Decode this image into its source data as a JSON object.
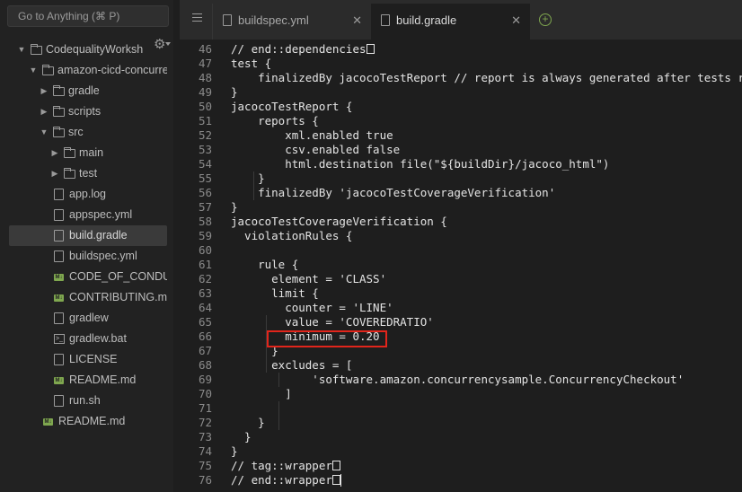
{
  "sidebar": {
    "search_placeholder": "Go to Anything (⌘ P)",
    "settings_icon": "gear-icon",
    "tree": [
      {
        "label": "CodequalityWorksh",
        "type": "folder",
        "expanded": true,
        "depth": 0
      },
      {
        "label": "amazon-cicd-concurren",
        "type": "folder",
        "expanded": true,
        "depth": 1
      },
      {
        "label": "gradle",
        "type": "folder",
        "expanded": false,
        "depth": 2
      },
      {
        "label": "scripts",
        "type": "folder",
        "expanded": false,
        "depth": 2
      },
      {
        "label": "src",
        "type": "folder",
        "expanded": true,
        "depth": 2
      },
      {
        "label": "main",
        "type": "folder",
        "expanded": false,
        "depth": 3
      },
      {
        "label": "test",
        "type": "folder",
        "expanded": false,
        "depth": 3
      },
      {
        "label": "app.log",
        "type": "file",
        "depth": 2
      },
      {
        "label": "appspec.yml",
        "type": "file",
        "depth": 2
      },
      {
        "label": "build.gradle",
        "type": "file",
        "depth": 2,
        "selected": true
      },
      {
        "label": "buildspec.yml",
        "type": "file",
        "depth": 2
      },
      {
        "label": "CODE_OF_CONDUC",
        "type": "md",
        "depth": 2
      },
      {
        "label": "CONTRIBUTING.md",
        "type": "md",
        "depth": 2
      },
      {
        "label": "gradlew",
        "type": "file",
        "depth": 2
      },
      {
        "label": "gradlew.bat",
        "type": "terminal",
        "depth": 2
      },
      {
        "label": "LICENSE",
        "type": "file",
        "depth": 2
      },
      {
        "label": "README.md",
        "type": "md",
        "depth": 2
      },
      {
        "label": "run.sh",
        "type": "file",
        "depth": 2
      },
      {
        "label": "README.md",
        "type": "md",
        "depth": 1
      }
    ]
  },
  "tabs": [
    {
      "label": "buildspec.yml",
      "active": false
    },
    {
      "label": "build.gradle",
      "active": true
    }
  ],
  "code_lines": [
    {
      "n": "46",
      "text": "// end::dependencies",
      "box": true
    },
    {
      "n": "47",
      "text": "test {"
    },
    {
      "n": "48",
      "text": "    finalizedBy jacocoTestReport // report is always generated after tests run"
    },
    {
      "n": "49",
      "text": "}"
    },
    {
      "n": "50",
      "text": "jacocoTestReport {"
    },
    {
      "n": "51",
      "text": "    reports {"
    },
    {
      "n": "52",
      "text": "        xml.enabled true"
    },
    {
      "n": "53",
      "text": "        csv.enabled false"
    },
    {
      "n": "54",
      "text": "        html.destination file(\"${buildDir}/jacoco_html\")"
    },
    {
      "n": "55",
      "text": "    }"
    },
    {
      "n": "56",
      "text": "    finalizedBy 'jacocoTestCoverageVerification'"
    },
    {
      "n": "57",
      "text": "}"
    },
    {
      "n": "58",
      "text": "jacocoTestCoverageVerification {"
    },
    {
      "n": "59",
      "text": "  violationRules {"
    },
    {
      "n": "60",
      "text": ""
    },
    {
      "n": "61",
      "text": "    rule {"
    },
    {
      "n": "62",
      "text": "      element = 'CLASS'"
    },
    {
      "n": "63",
      "text": "      limit {"
    },
    {
      "n": "64",
      "text": "        counter = 'LINE'"
    },
    {
      "n": "65",
      "text": "        value = 'COVEREDRATIO'"
    },
    {
      "n": "66",
      "text": "        minimum = 0.20"
    },
    {
      "n": "67",
      "text": "      }"
    },
    {
      "n": "68",
      "text": "      excludes = ["
    },
    {
      "n": "69",
      "text": "            'software.amazon.concurrencysample.ConcurrencyCheckout'"
    },
    {
      "n": "70",
      "text": "        ]"
    },
    {
      "n": "71",
      "text": ""
    },
    {
      "n": "72",
      "text": "    }"
    },
    {
      "n": "73",
      "text": "  }"
    },
    {
      "n": "74",
      "text": "}"
    },
    {
      "n": "75",
      "text": "// tag::wrapper",
      "box": true
    },
    {
      "n": "76",
      "text": "// end::wrapper",
      "box": true,
      "caret": true
    }
  ],
  "colors": {
    "highlight_box": "#e1251b",
    "add_tab": "#7fa74f"
  }
}
